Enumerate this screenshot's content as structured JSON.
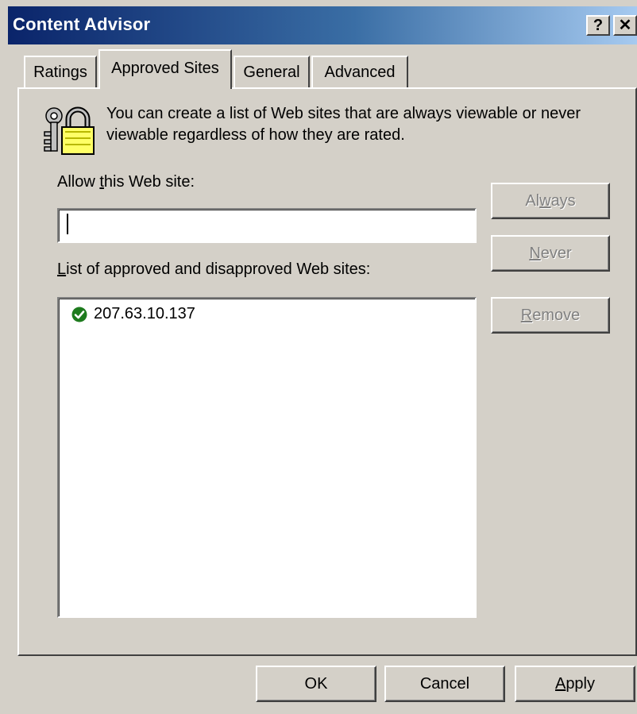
{
  "window": {
    "title": "Content Advisor",
    "help_glyph": "?",
    "close_glyph": "✕"
  },
  "tabs": [
    {
      "label": "Ratings",
      "selected": false
    },
    {
      "label": "Approved Sites",
      "selected": true
    },
    {
      "label": "General",
      "selected": false
    },
    {
      "label": "Advanced",
      "selected": false
    }
  ],
  "intro_text": "You can create a list of Web sites that are always viewable or never viewable regardless of how they are rated.",
  "allow_label": {
    "before": "Allow ",
    "accel": "t",
    "after": "his Web site:"
  },
  "site_input": {
    "value": ""
  },
  "list_label": {
    "accel": "L",
    "after": "ist of approved and disapproved Web sites:"
  },
  "sites": [
    {
      "address": "207.63.10.137",
      "status": "approved",
      "icon": "green-check-icon"
    }
  ],
  "side_buttons": {
    "always": {
      "before": "Al",
      "accel": "w",
      "after": "ays",
      "enabled": false
    },
    "never": {
      "before": "",
      "accel": "N",
      "after": "ever",
      "enabled": false
    },
    "remove": {
      "before": "",
      "accel": "R",
      "after": "emove",
      "enabled": false
    }
  },
  "footer_buttons": {
    "ok": "OK",
    "cancel": "Cancel",
    "apply": {
      "accel": "A",
      "after": "pply"
    }
  },
  "colors": {
    "titlebar_start": "#0a246a",
    "titlebar_end": "#a6caf0",
    "face": "#d4d0c8",
    "approved_check": "#1e7b1e"
  }
}
